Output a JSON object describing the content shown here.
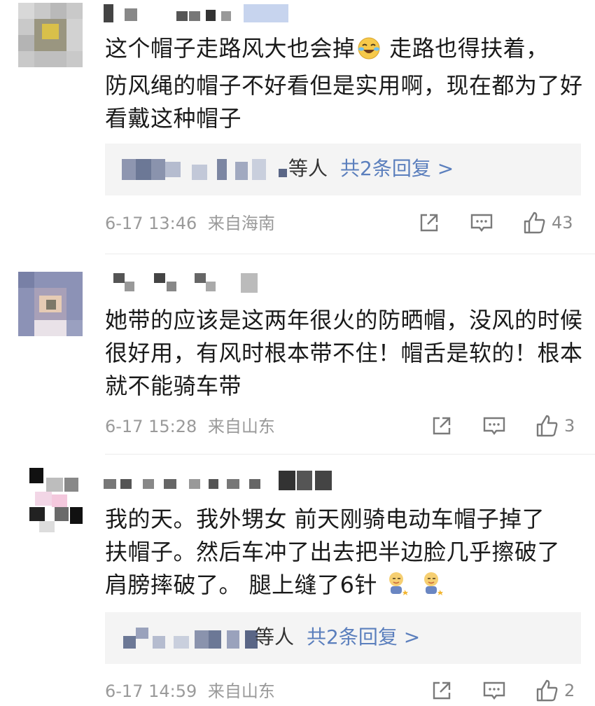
{
  "comments": [
    {
      "text_line1": "这个帽子走路风大也会掉",
      "text_line1_after": " 走路也得扶着，",
      "text_rest": "防风绳的帽子不好看但是实用啊，现在都为了好看戴这种帽子",
      "reply_suffix": "等人",
      "reply_link": "共2条回复 >",
      "time": "6-17 13:46",
      "location": "来自海南",
      "likes": "43"
    },
    {
      "text": "她带的应该是这两年很火的防晒帽，没风的时候很好用，有风时根本带不住！帽舌是软的！根本就不能骑车带",
      "time": "6-17 15:28",
      "location": "来自山东",
      "likes": "3"
    },
    {
      "text_line1": "我的天。我外甥女 前天刚骑电动车帽子掉了",
      "text_line2": "扶帽子。然后车冲了出去把半边脸几乎擦破了",
      "text_line3": "肩膀摔破了。 腿上缝了6针",
      "reply_suffix": "等人",
      "reply_link": "共2条回复 >",
      "time": "6-17 14:59",
      "location": "来自山东",
      "likes": "2"
    }
  ],
  "icons": {
    "share": "share-icon",
    "comment": "comment-icon",
    "like": "thumbs-up-icon",
    "emoji_laugh": "laughing-crying-emoji-icon",
    "emoji_baby": "baby-emoji-icon"
  },
  "colors": {
    "link": "#5b7fbd",
    "meta": "#9a9a9a",
    "reply_bg": "#f4f4f4"
  }
}
